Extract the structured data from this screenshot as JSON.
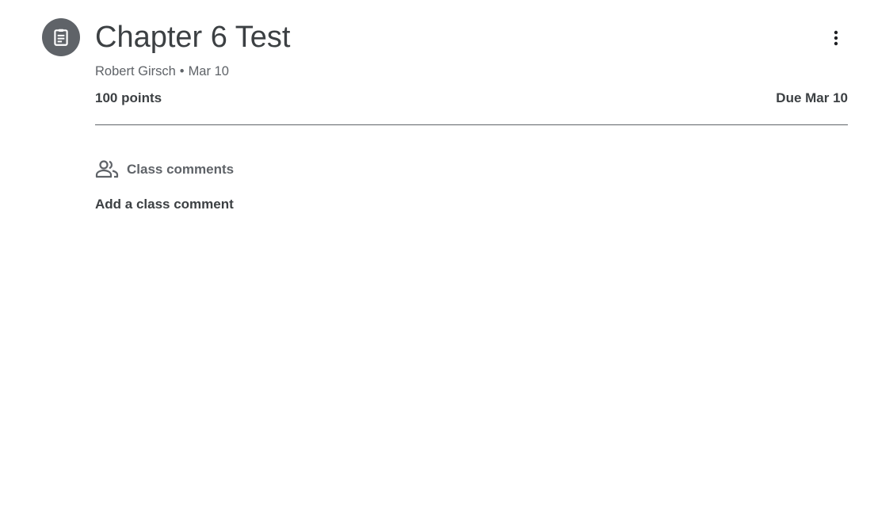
{
  "assignment": {
    "icon": "assignment-clipboard-icon",
    "title": "Chapter 6 Test",
    "author": "Robert Girsch",
    "separator": "•",
    "posted_date": "Mar 10",
    "points": "100 points",
    "due": "Due Mar 10",
    "more_icon": "more-vert-icon"
  },
  "comments": {
    "icon": "people-icon",
    "header_label": "Class comments",
    "add_label": "Add a class comment"
  },
  "colors": {
    "icon_background": "#5f6368",
    "primary_text": "#3c4043",
    "secondary_text": "#5f6368",
    "background": "#ffffff"
  }
}
